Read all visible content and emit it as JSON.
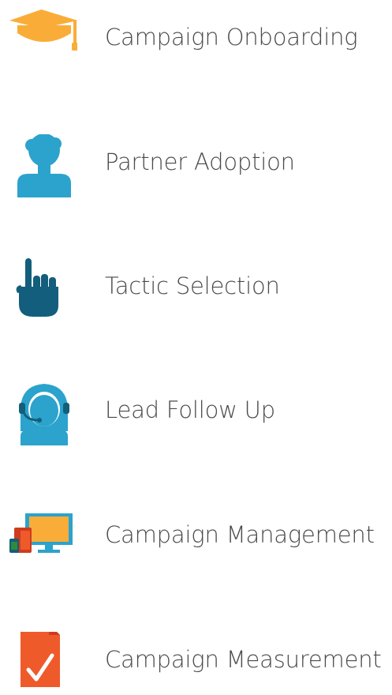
{
  "colors": {
    "text": "#4a4a4a",
    "orange": "#f9ad38",
    "blue": "#2ba3cc",
    "dark_teal": "#135e7c",
    "red_orange": "#ef5a2a",
    "dark_red": "#cf3b1f",
    "green": "#2e8b3a"
  },
  "items": [
    {
      "label": "Campaign Onboarding",
      "icon": "graduation-cap-icon"
    },
    {
      "label": "Partner Adoption",
      "icon": "person-icon"
    },
    {
      "label": "Tactic Selection",
      "icon": "pointing-hand-icon"
    },
    {
      "label": "Lead Follow Up",
      "icon": "headset-agent-icon"
    },
    {
      "label": "Campaign Management",
      "icon": "devices-icon"
    },
    {
      "label": "Campaign Measurement",
      "icon": "checkmark-document-icon"
    }
  ]
}
